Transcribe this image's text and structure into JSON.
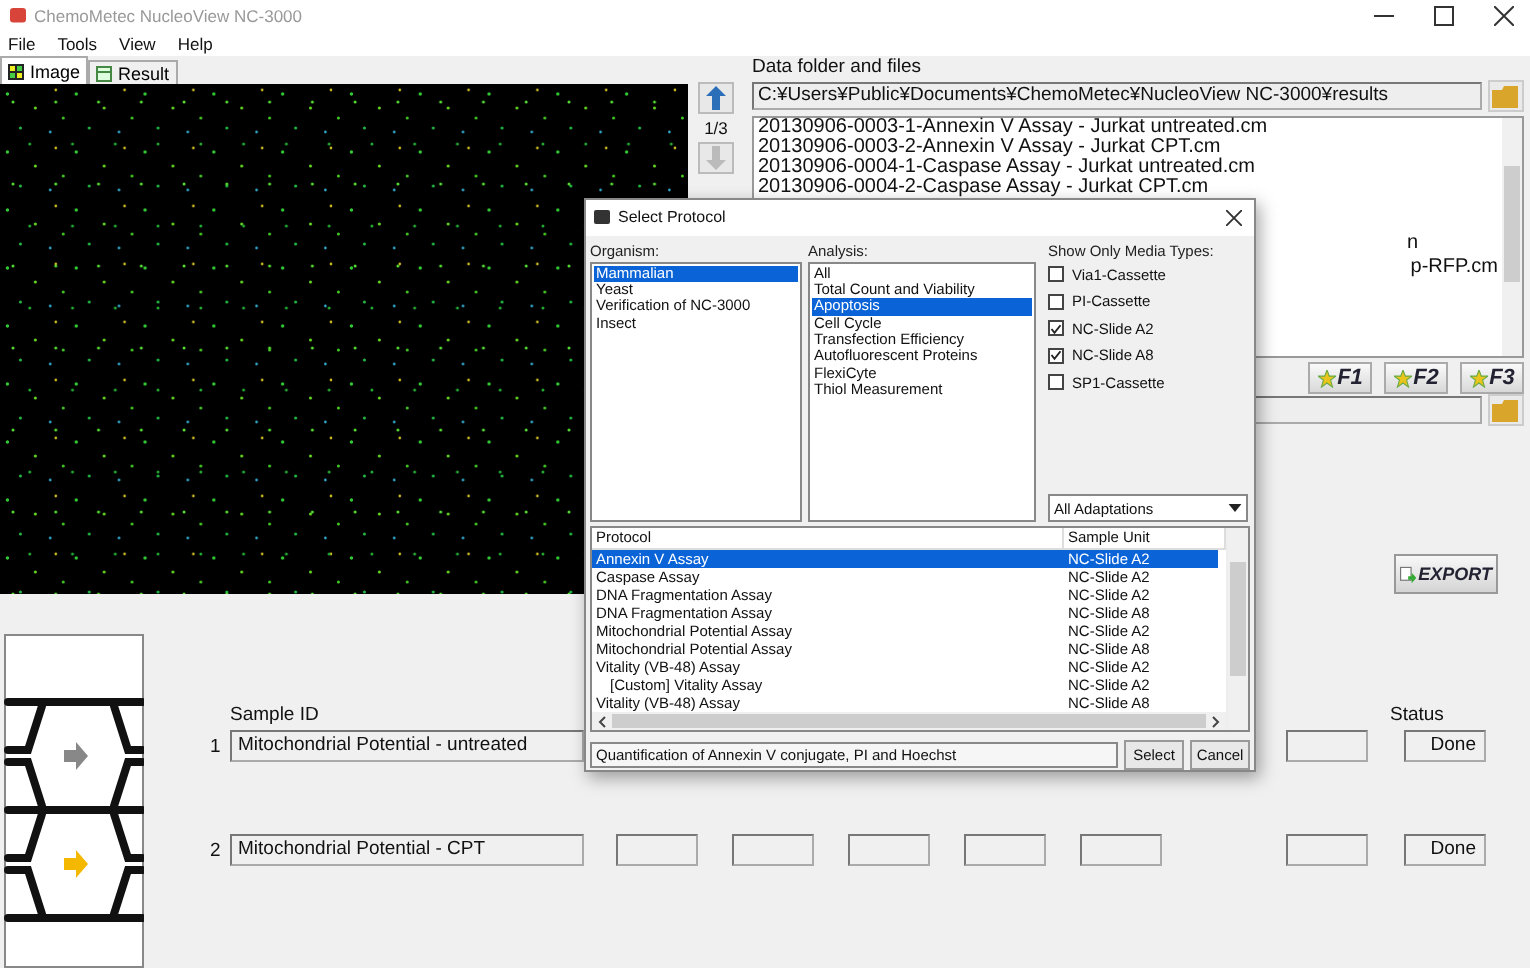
{
  "window": {
    "title": "ChemoMetec NucleoView NC-3000"
  },
  "menu": [
    "File",
    "Tools",
    "View",
    "Help"
  ],
  "tabs": [
    {
      "label": "Image",
      "selected": true
    },
    {
      "label": "Result",
      "selected": false
    }
  ],
  "image_nav": {
    "counter": "1/3"
  },
  "data_folder": {
    "label": "Data folder and files",
    "path": "C:¥Users¥Public¥Documents¥ChemoMetec¥NucleoView NC-3000¥results"
  },
  "files": [
    {
      "kind": "full",
      "name": "20130906-0003-1-Annexin V Assay - Jurkat untreated.cm"
    },
    {
      "kind": "full",
      "name": "20130906-0003-2-Annexin V Assay - Jurkat CPT.cm"
    },
    {
      "kind": "full",
      "name": "20130906-0004-1-Caspase Assay - Jurkat untreated.cm"
    },
    {
      "kind": "full",
      "name": "20130906-0004-2-Caspase Assay - Jurkat CPT.cm"
    },
    {
      "kind": "tail",
      "name": "n"
    },
    {
      "kind": "tail",
      "name": "p-RFP.cm"
    }
  ],
  "favorites": [
    "F1",
    "F2",
    "F3"
  ],
  "export_button": "EXPORT",
  "samples": {
    "id_header": "Sample ID",
    "status_header": "Status",
    "rows": [
      {
        "kind": "partial",
        "number": "1",
        "sample_id": "Mitochondrial Potential - untreated",
        "status": "Done"
      },
      {
        "kind": "full",
        "number": "2",
        "sample_id": "Mitochondrial Potential - CPT",
        "status": "Done"
      }
    ]
  },
  "dialog": {
    "title": "Select Protocol",
    "organism": {
      "label": "Organism:",
      "items": [
        {
          "label": "Mammalian",
          "selected": true
        },
        {
          "label": "Yeast",
          "selected": false
        },
        {
          "label": "Verification of NC-3000",
          "selected": false
        },
        {
          "label": "Insect",
          "selected": false
        }
      ]
    },
    "analysis": {
      "label": "Analysis:",
      "items": [
        {
          "label": "All",
          "selected": false
        },
        {
          "label": "Total Count and Viability",
          "selected": false
        },
        {
          "label": "Apoptosis",
          "selected": true
        },
        {
          "label": "Cell Cycle",
          "selected": false
        },
        {
          "label": "Transfection Efficiency",
          "selected": false
        },
        {
          "label": "Autofluorescent Proteins",
          "selected": false
        },
        {
          "label": "FlexiCyte",
          "selected": false
        },
        {
          "label": "Thiol Measurement",
          "selected": false
        }
      ]
    },
    "media_types": {
      "label": "Show Only Media Types:",
      "items": [
        {
          "label": "Via1-Cassette",
          "checked": false
        },
        {
          "label": "PI-Cassette",
          "checked": false
        },
        {
          "label": "NC-Slide A2",
          "checked": true
        },
        {
          "label": "NC-Slide A8",
          "checked": true
        },
        {
          "label": "SP1-Cassette",
          "checked": false
        }
      ]
    },
    "adaptation": "All Adaptations",
    "protocols": {
      "columns": [
        "Protocol",
        "Sample Unit"
      ],
      "rows": [
        {
          "protocol": "Annexin V Assay",
          "sample_unit": "NC-Slide A2",
          "selected": true
        },
        {
          "protocol": "Caspase Assay",
          "sample_unit": "NC-Slide A2",
          "selected": false
        },
        {
          "protocol": "DNA Fragmentation Assay",
          "sample_unit": "NC-Slide A2",
          "selected": false
        },
        {
          "protocol": "DNA Fragmentation Assay",
          "sample_unit": "NC-Slide A8",
          "selected": false
        },
        {
          "protocol": "Mitochondrial Potential Assay",
          "sample_unit": "NC-Slide A2",
          "selected": false
        },
        {
          "protocol": "Mitochondrial Potential Assay",
          "sample_unit": "NC-Slide A8",
          "selected": false
        },
        {
          "protocol": "Vitality (VB-48) Assay",
          "sample_unit": "NC-Slide A2",
          "selected": false,
          "children": [
            {
              "protocol": "[Custom] Vitality Assay",
              "sample_unit": "NC-Slide A2",
              "selected": false
            }
          ]
        },
        {
          "protocol": "Vitality (VB-48) Assay",
          "sample_unit": "NC-Slide A8",
          "selected": false
        }
      ]
    },
    "description": "Quantification of Annexin V conjugate, PI and Hoechst",
    "buttons": [
      "Select",
      "Cancel"
    ]
  }
}
